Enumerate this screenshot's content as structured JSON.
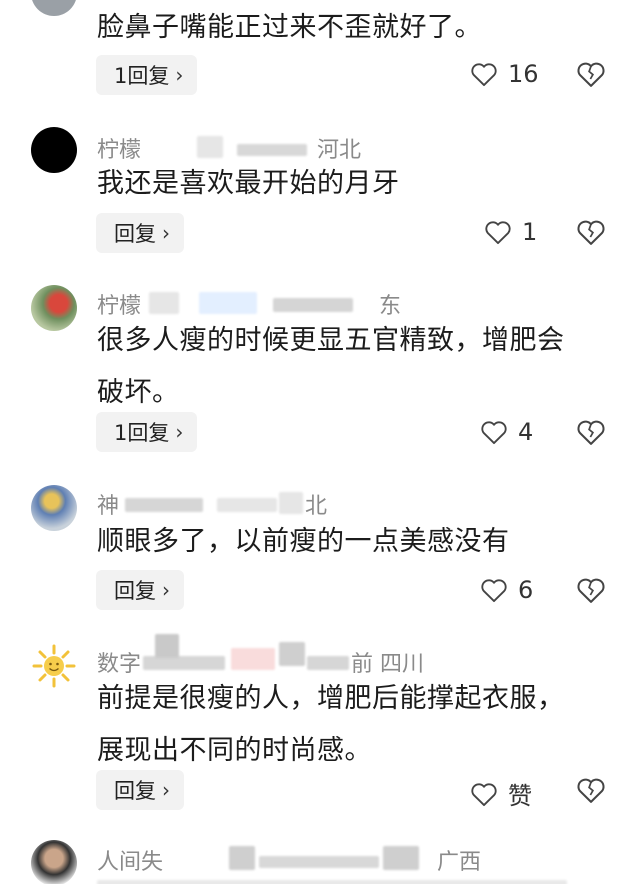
{
  "comments": [
    {
      "meta": "",
      "text": "脸鼻子嘴能正过来不歪就好了。",
      "reply_label": "1回复",
      "like_count": "16"
    },
    {
      "meta": "柠檬",
      "meta_tail": "河北",
      "text": "我还是喜欢最开始的月牙",
      "reply_label": "回复",
      "like_count": "1"
    },
    {
      "meta": "柠檬",
      "meta_tail": "东",
      "text_line1": "很多人瘦的时候更显五官精致，增肥会",
      "text_line2": "破坏。",
      "reply_label": "1回复",
      "like_count": "4"
    },
    {
      "meta": "神",
      "meta_tail": "北",
      "text": "顺眼多了，以前瘦的一点美感没有",
      "reply_label": "回复",
      "like_count": "6"
    },
    {
      "meta": "数字",
      "meta_tail": "前  四川",
      "text_line1": "前提是很瘦的人，增肥后能撑起衣服，",
      "text_line2": "展现出不同的时尚感。",
      "reply_label": "回复",
      "like_count": "赞"
    },
    {
      "meta": "人间失",
      "meta_tail": "广西"
    }
  ],
  "icons": {
    "like": "heart-outline-icon",
    "dislike": "broken-heart-icon",
    "chevron": "chevron-right-icon"
  }
}
